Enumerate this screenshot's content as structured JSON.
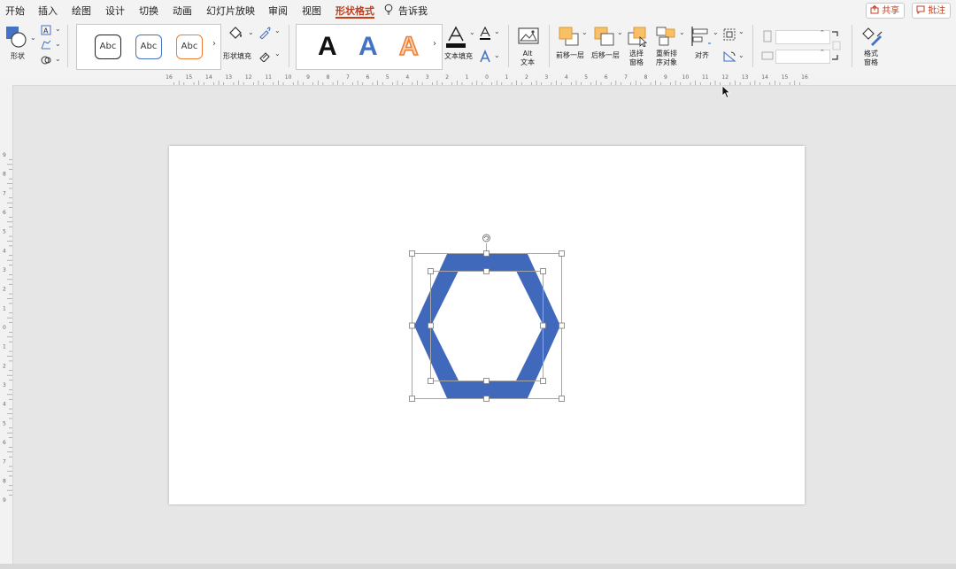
{
  "menu": {
    "items": [
      "开始",
      "插入",
      "绘图",
      "设计",
      "切换",
      "动画",
      "幻灯片放映",
      "审阅",
      "视图",
      "形状格式"
    ],
    "tell_me": "告诉我",
    "share_label": "共享",
    "comments_label": "批注"
  },
  "ribbon": {
    "shape_label": "形状",
    "style_samples": [
      "Abc",
      "Abc",
      "Abc"
    ],
    "shape_fill_label": "形状填充",
    "wordart_sample": "A",
    "text_fill_label": "文本填充",
    "alt_text_label": "Alt\n文本",
    "bring_forward_label": "前移一层",
    "send_backward_label": "后移一层",
    "selection_pane_label": "选择\n窗格",
    "reorder_label": "重新排\n序对象",
    "align_label": "对齐",
    "format_pane_label": "格式\n窗格"
  },
  "ruler": {
    "h_ticks": [
      "16",
      "15",
      "14",
      "13",
      "12",
      "11",
      "10",
      "9",
      "8",
      "7",
      "6",
      "5",
      "4",
      "3",
      "2",
      "1",
      "0",
      "1",
      "2",
      "3",
      "4",
      "5",
      "6",
      "7",
      "8",
      "9",
      "10",
      "11",
      "12",
      "13",
      "14",
      "15",
      "16"
    ],
    "v_ticks": [
      "9",
      "8",
      "7",
      "6",
      "5",
      "4",
      "3",
      "2",
      "1",
      "0",
      "1",
      "2",
      "3",
      "4",
      "5",
      "6",
      "7",
      "8",
      "9"
    ]
  },
  "shape": {
    "fill_color": "#4068bb",
    "frame_color": "#a6a6a6"
  },
  "colors": {
    "accent": "#c43e1c",
    "text_outline_blue": "#4472c4",
    "text_outline_orange": "#ed7d31",
    "arrange_yellow": "#f9c066"
  }
}
